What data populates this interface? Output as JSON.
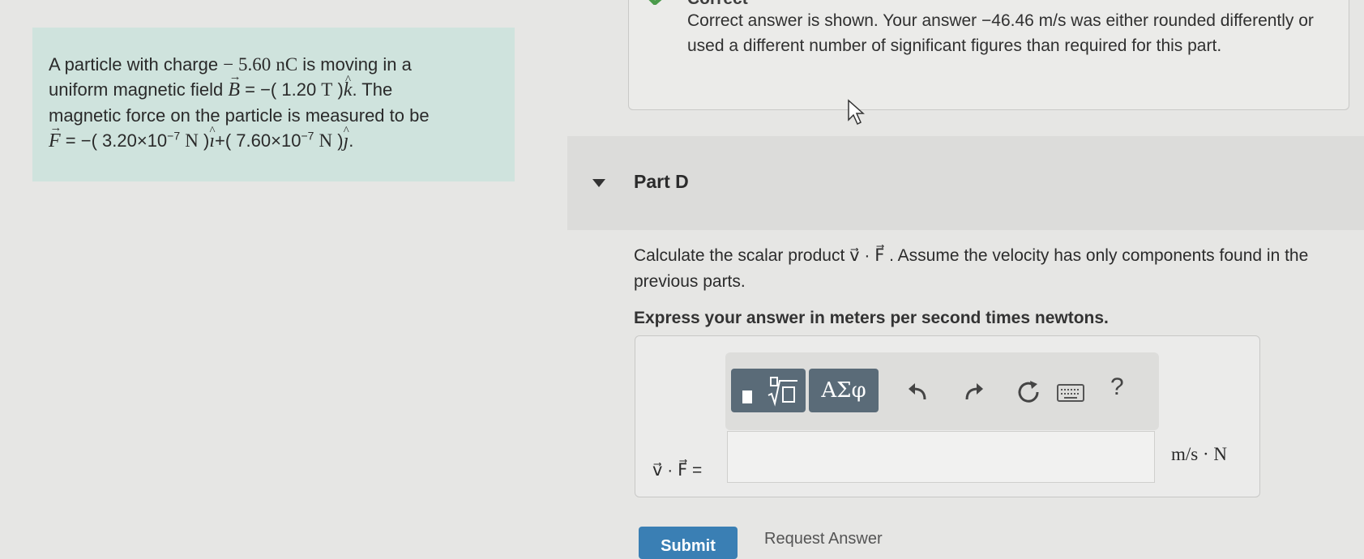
{
  "problem": {
    "line1_pre": "A particle with charge ",
    "charge_value": "− 5.60",
    "charge_unit": "nC",
    "line1_post": " is moving in a",
    "line2_pre": "uniform magnetic field ",
    "b_symbol": "B",
    "b_eq": " = −( 1.20 ",
    "b_unit": "T",
    "b_close": " )",
    "k_symbol": "k",
    "line2_post": ". The",
    "line3": "magnetic force on the particle is measured to be",
    "f_symbol": "F",
    "f_part1": " = −( 3.20×10",
    "exp1": "−7",
    "n_unit": "N",
    "f_close1": " )",
    "i_symbol": "ı",
    "f_part2": "+( 7.60×10",
    "exp2": "−7",
    "f_close2": " )",
    "j_symbol": "ȷ",
    "f_end": "."
  },
  "feedback": {
    "title": "Correct",
    "message": "Correct answer is shown. Your answer −46.46 m/s was either rounded differently or used a different number of significant figures than required for this part."
  },
  "part_d": {
    "title": "Part D",
    "question": "Calculate the scalar product v⃗ · F⃗ . Assume the velocity has only components found in the previous parts.",
    "instruction": "Express your answer in meters per second times newtons.",
    "input_label": "v⃗ · F⃗ =",
    "input_value": "",
    "unit": "m/s · N"
  },
  "toolbar": {
    "symbols_label": "ΑΣφ",
    "help_label": "?"
  },
  "actions": {
    "submit_label": "Submit",
    "request_label": "Request Answer"
  }
}
